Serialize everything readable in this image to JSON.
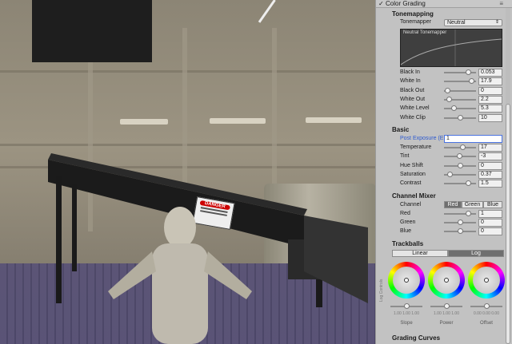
{
  "colors": {
    "accent": "#4a73e0",
    "panel": "#c2c2c2",
    "selected_seg": "#6f6f6f"
  },
  "scene": {
    "sign_title": "DANGER"
  },
  "inspector": {
    "header": {
      "title": "Color Grading",
      "check": "✓",
      "menu_icon": "≡"
    },
    "tonemapping": {
      "title": "Tonemapping",
      "tonemapper_label": "Tonemapper",
      "tonemapper_value": "Neutral",
      "curve_title": "Neutral Tonemapper",
      "rows": [
        {
          "label": "Black In",
          "value": "0.053",
          "pos": 0.75
        },
        {
          "label": "White In",
          "value": "17.9",
          "pos": 0.85
        },
        {
          "label": "Black Out",
          "value": "0",
          "pos": 0.1
        },
        {
          "label": "White Out",
          "value": "2.2",
          "pos": 0.15
        },
        {
          "label": "White Level",
          "value": "5.3",
          "pos": 0.3
        },
        {
          "label": "White Clip",
          "value": "10",
          "pos": 0.5
        }
      ]
    },
    "basic": {
      "title": "Basic",
      "post_exposure_label": "Post Exposure (E",
      "post_exposure_value": "1",
      "rows": [
        {
          "label": "Temperature",
          "value": "17",
          "pos": 0.58
        },
        {
          "label": "Tint",
          "value": "-3",
          "pos": 0.48
        },
        {
          "label": "Hue Shift",
          "value": "0",
          "pos": 0.5
        },
        {
          "label": "Saturation",
          "value": "0.37",
          "pos": 0.18
        },
        {
          "label": "Contrast",
          "value": "1.5",
          "pos": 0.75
        }
      ]
    },
    "channel_mixer": {
      "title": "Channel Mixer",
      "channel_label": "Channel",
      "channels": [
        "Red",
        "Green",
        "Blue"
      ],
      "selected": "Red",
      "rows": [
        {
          "label": "Red",
          "value": "1",
          "pos": 0.75
        },
        {
          "label": "Green",
          "value": "0",
          "pos": 0.5
        },
        {
          "label": "Blue",
          "value": "0",
          "pos": 0.5
        }
      ]
    },
    "trackballs": {
      "title": "Trackballs",
      "tabs": [
        "Linear",
        "Log"
      ],
      "selected_tab": "Log",
      "side_label": "Log Controls",
      "wheels": [
        {
          "label": "Slope",
          "values": "1.00  1.00  1.00"
        },
        {
          "label": "Power",
          "values": "1.00  1.00  1.00"
        },
        {
          "label": "Offset",
          "values": "0.00  0.00  0.00"
        }
      ]
    },
    "grading_curves": {
      "title": "Grading Curves"
    }
  }
}
